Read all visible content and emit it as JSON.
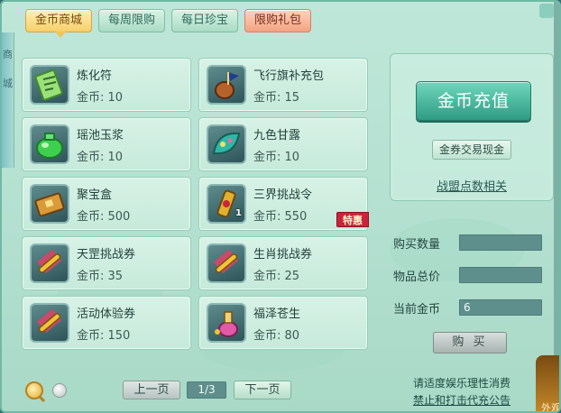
{
  "tabs": [
    {
      "label": "金币商城",
      "active": true
    },
    {
      "label": "每周限购",
      "active": false
    },
    {
      "label": "每日珍宝",
      "active": false
    },
    {
      "label": "限购礼包",
      "active": false
    }
  ],
  "price_prefix": "金币: ",
  "items": [
    {
      "name": "炼化符",
      "price": "金币: 10",
      "icon": "talisman-icon",
      "color": "#7fd16a"
    },
    {
      "name": "飞行旗补充包",
      "price": "金币: 15",
      "icon": "flag-pack-icon",
      "color": "#c46a2a"
    },
    {
      "name": "瑶池玉浆",
      "price": "金币: 10",
      "icon": "jade-potion-icon",
      "color": "#3fbf4f"
    },
    {
      "name": "九色甘露",
      "price": "金币: 10",
      "icon": "nectar-leaf-icon",
      "color": "#2fa8a0"
    },
    {
      "name": "聚宝盒",
      "price": "金币: 500",
      "icon": "treasure-box-icon",
      "color": "#c8872a"
    },
    {
      "name": "三界挑战令",
      "price": "金币: 550",
      "icon": "challenge-token-icon",
      "color": "#d6a52a",
      "qty": "1",
      "badge": "特惠"
    },
    {
      "name": "天罡挑战券",
      "price": "金币: 35",
      "icon": "scroll-icon",
      "color": "#d6a52a"
    },
    {
      "name": "生肖挑战券",
      "price": "金币: 25",
      "icon": "scroll-icon",
      "color": "#d6a52a"
    },
    {
      "name": "活动体验券",
      "price": "金币: 150",
      "icon": "scroll-icon",
      "color": "#d6a52a"
    },
    {
      "name": "福泽苍生",
      "price": "金币: 80",
      "icon": "blessing-bottle-icon",
      "color": "#d84aa0"
    }
  ],
  "right_panel": {
    "topup_label": "金币充值",
    "exchange_label": "金券交易现金",
    "alliance_label": "战盟点数相关"
  },
  "form": {
    "qty_label": "购买数量",
    "qty_value": "",
    "total_label": "物品总价",
    "total_value": "",
    "current_label": "当前金币",
    "current_value": "6",
    "buy_label": "购 买"
  },
  "pager": {
    "prev_label": "上一页",
    "page": "1/3",
    "next_label": "下一页"
  },
  "notice": {
    "line1": "请适度娱乐理性消费",
    "line2": "禁止和打击代充公告"
  },
  "left_edge": {
    "chars": [
      "商",
      "城"
    ]
  },
  "corner_label": "外观"
}
